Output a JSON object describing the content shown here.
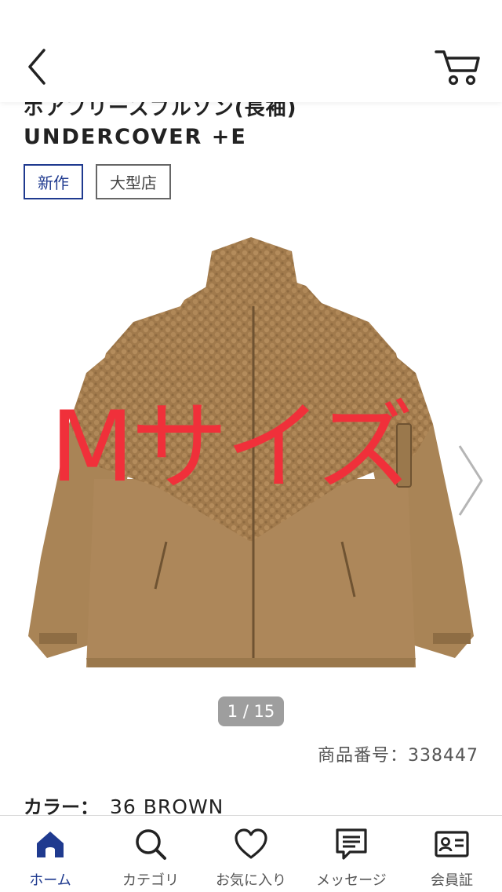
{
  "header": {
    "back_icon": "chevron-left-icon",
    "cart_icon": "cart-icon"
  },
  "product": {
    "title_jp": "ボアフリースブルゾン(長袖)",
    "title_en": "UNDERCOVER +E",
    "tags": [
      "新作",
      "大型店"
    ],
    "overlay_text": "Mサイズ",
    "image_pager": "1 / 15",
    "product_number": "商品番号：338447",
    "color_label": "カラー：",
    "color_value": "36 BROWN"
  },
  "colors": {
    "accent": "#1f3a8f",
    "overlay_red": "#f0303a",
    "jacket_brown": "#a98456"
  },
  "tabbar": {
    "items": [
      {
        "label": "ホーム",
        "icon": "home-icon",
        "active": true
      },
      {
        "label": "カテゴリ",
        "icon": "search-icon",
        "active": false
      },
      {
        "label": "お気に入り",
        "icon": "heart-icon",
        "active": false
      },
      {
        "label": "メッセージ",
        "icon": "message-icon",
        "active": false
      },
      {
        "label": "会員証",
        "icon": "member-card-icon",
        "active": false
      }
    ]
  }
}
